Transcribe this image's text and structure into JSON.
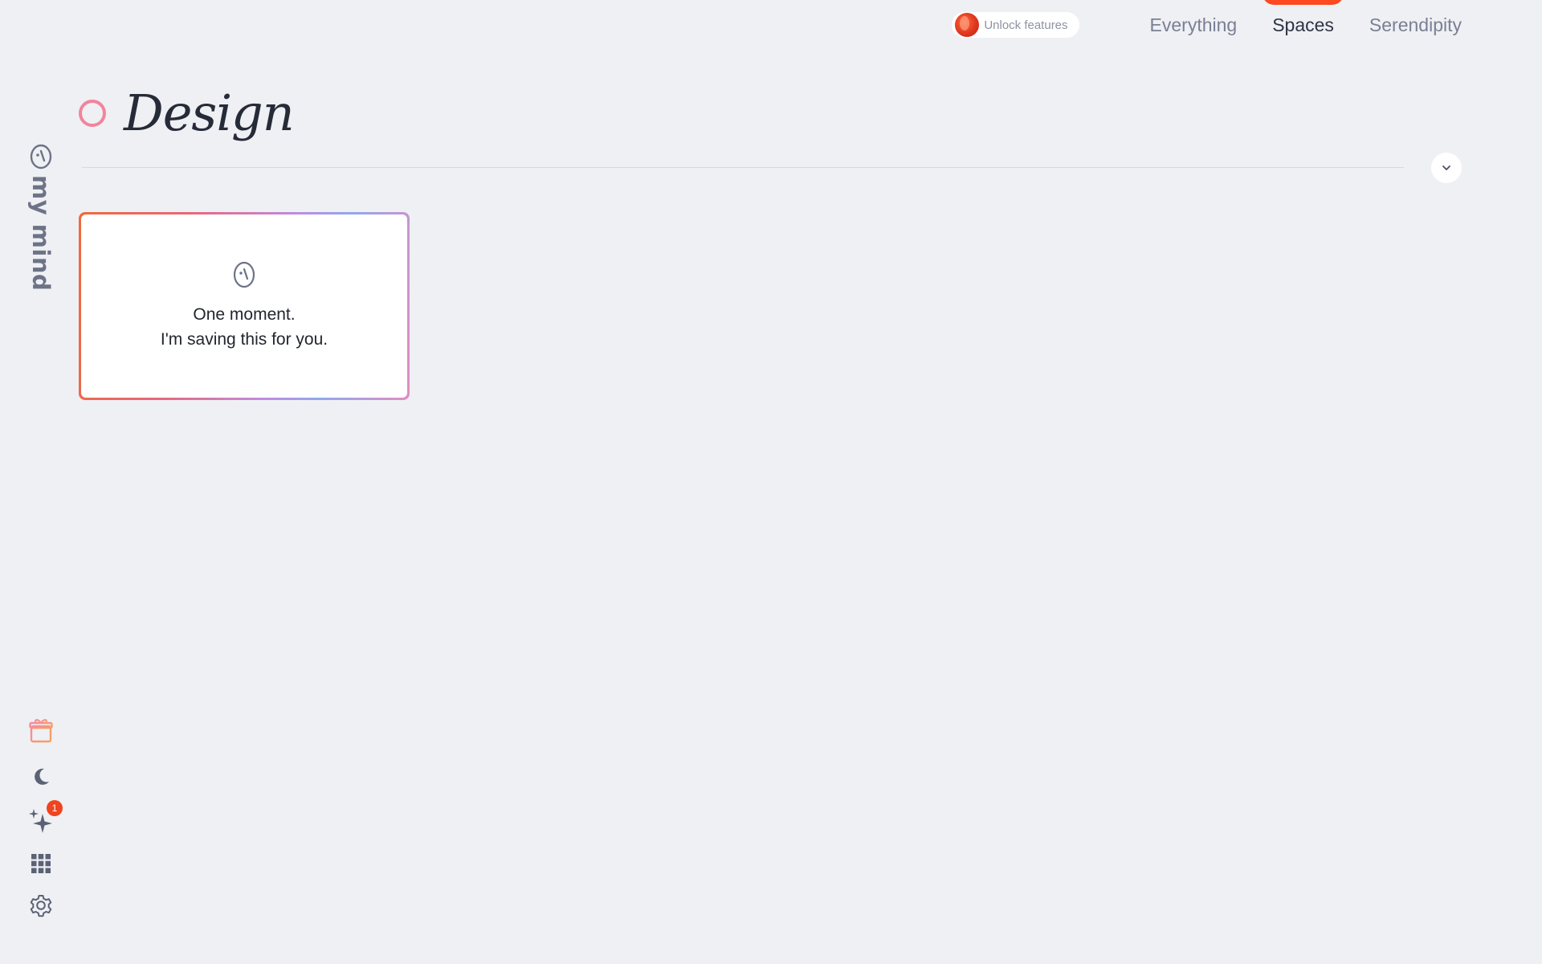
{
  "topnav": {
    "unlock_label": "Unlock features",
    "tabs": [
      {
        "label": "Everything",
        "active": false
      },
      {
        "label": "Spaces",
        "active": true
      },
      {
        "label": "Serendipity",
        "active": false
      }
    ],
    "accent_color": "#ff4a1f"
  },
  "brand": {
    "name": "my mind",
    "icon": "mind-logo-icon"
  },
  "space": {
    "title": "Design",
    "dot_color": "#f2849c"
  },
  "card": {
    "icon": "mind-logo-icon",
    "line1": "One moment.",
    "line2": "I'm saving this for you."
  },
  "rail": {
    "items": [
      {
        "icon": "gift-icon"
      },
      {
        "icon": "moon-icon"
      },
      {
        "icon": "sparkles-icon",
        "badge": "1"
      },
      {
        "icon": "grid-icon"
      },
      {
        "icon": "gear-icon"
      }
    ],
    "badge_color": "#f0431f"
  }
}
